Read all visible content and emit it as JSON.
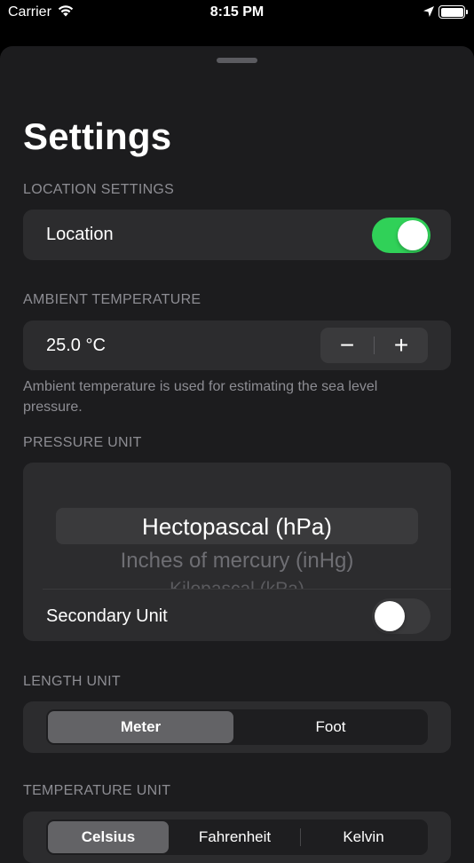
{
  "status_bar": {
    "carrier": "Carrier",
    "time": "8:15 PM"
  },
  "title": "Settings",
  "location_section": {
    "header": "LOCATION SETTINGS",
    "location_label": "Location",
    "location_enabled": true
  },
  "ambient_section": {
    "header": "AMBIENT TEMPERATURE",
    "value": "25.0 °C",
    "decrement_label": "−",
    "increment_label": "+",
    "footer": "Ambient temperature is used for estimating the sea level pressure."
  },
  "pressure_section": {
    "header": "PRESSURE UNIT",
    "options": [
      "Hectopascal (hPa)",
      "Inches of mercury (inHg)",
      "Kilopascal (kPa)"
    ],
    "selected": "Hectopascal (hPa)",
    "secondary_label": "Secondary Unit",
    "secondary_enabled": false
  },
  "length_section": {
    "header": "LENGTH UNIT",
    "segments": [
      "Meter",
      "Foot"
    ],
    "selected": "Meter"
  },
  "temperature_section": {
    "header": "TEMPERATURE UNIT",
    "segments": [
      "Celsius",
      "Fahrenheit",
      "Kelvin"
    ],
    "selected": "Celsius"
  },
  "colors": {
    "toggle_on": "#30d158",
    "card": "#2c2c2e",
    "sheet": "#1c1c1e",
    "secondary_text": "#8d8d93"
  }
}
